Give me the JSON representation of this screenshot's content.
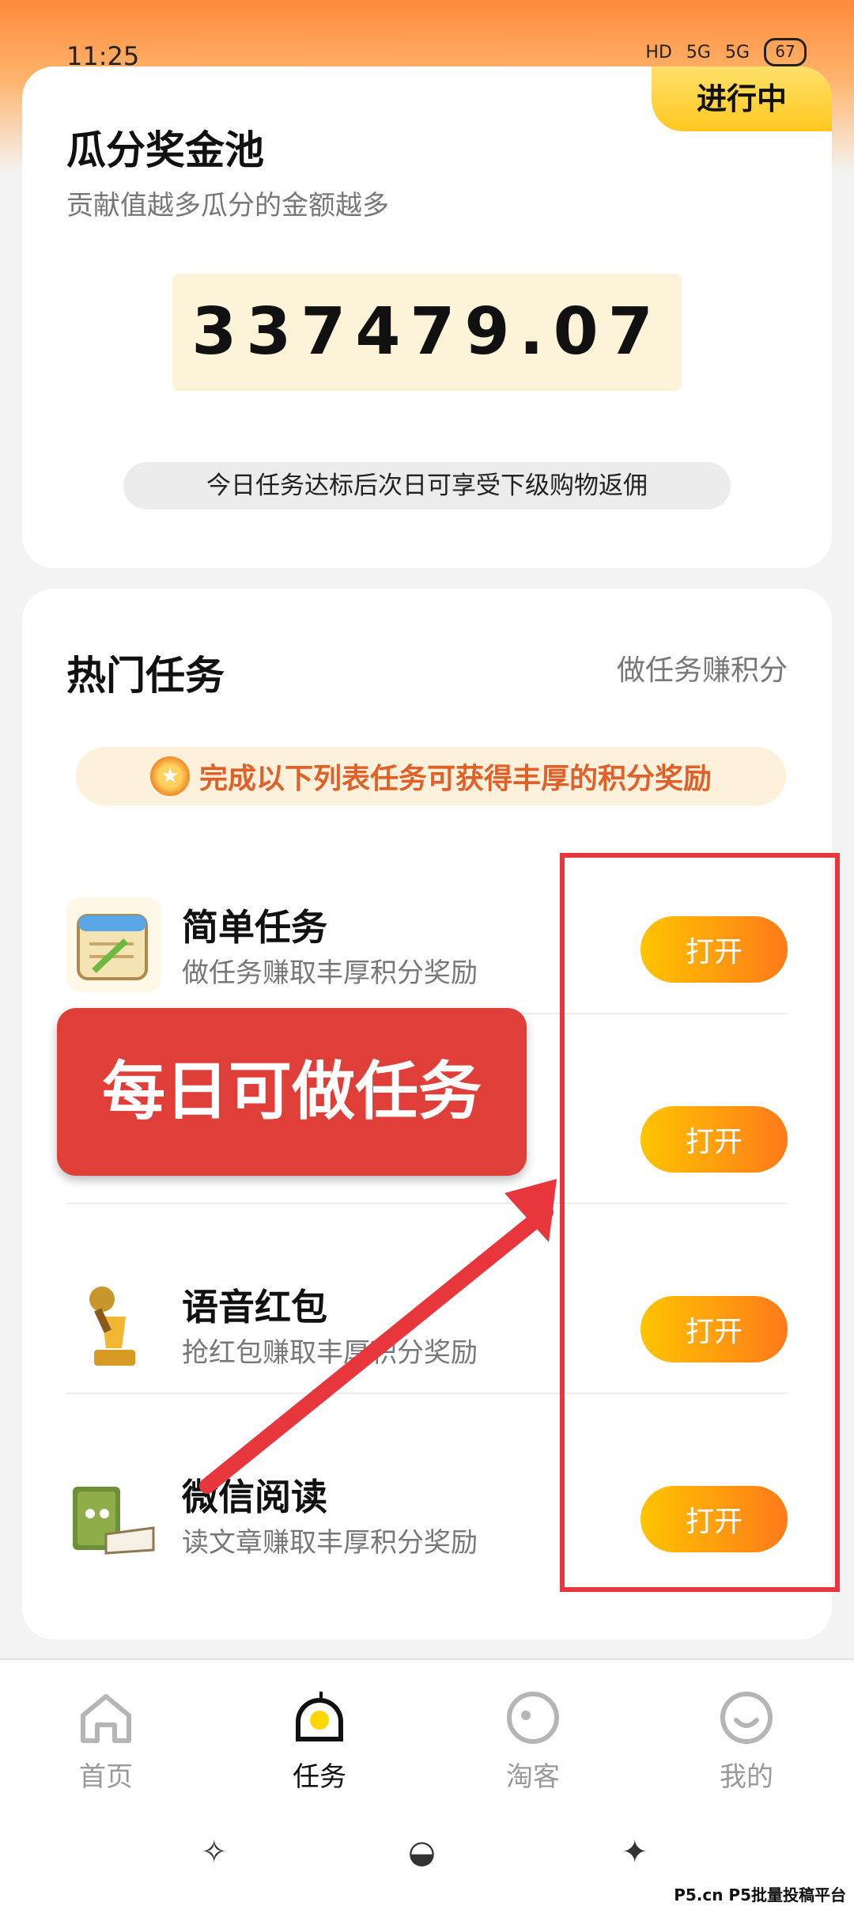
{
  "status_bar": {
    "time": "11:25",
    "icons": [
      "HD",
      "5G",
      "5G"
    ],
    "battery": "67"
  },
  "pool_card": {
    "status_tag": "进行中",
    "title": "瓜分奖金池",
    "subtitle": "贡献值越多瓜分的金额越多",
    "amount": "337479.07",
    "note": "今日任务达标后次日可享受下级购物返佣"
  },
  "tasks_card": {
    "title": "热门任务",
    "link": "做任务赚积分",
    "reward_banner": "完成以下列表任务可获得丰厚的积分奖励",
    "open_label": "打开",
    "items": [
      {
        "name": "简单任务",
        "desc": "做任务赚取丰厚积分奖励",
        "icon": "calendar-icon"
      },
      {
        "name": "",
        "desc": "",
        "icon": ""
      },
      {
        "name": "语音红包",
        "desc": "抢红包赚取丰厚积分奖励",
        "icon": "trophy-microphone-icon"
      },
      {
        "name": "微信阅读",
        "desc": "读文章赚取丰厚积分奖励",
        "icon": "book-icon"
      }
    ]
  },
  "overlay": {
    "banner_text": "每日可做任务",
    "highlight_color": "#e8363d",
    "arrow_color": "#e8363d"
  },
  "bottom_nav": {
    "items": [
      {
        "label": "首页",
        "icon": "home-icon"
      },
      {
        "label": "任务",
        "icon": "task-icon",
        "active": true
      },
      {
        "label": "淘客",
        "icon": "taoke-icon"
      },
      {
        "label": "我的",
        "icon": "profile-icon"
      }
    ]
  },
  "watermark": "P5.cn P5批量投稿平台",
  "colors": {
    "accent_orange": "#ff7a1a",
    "accent_yellow": "#ffc400",
    "banner_red": "#df3f38"
  }
}
